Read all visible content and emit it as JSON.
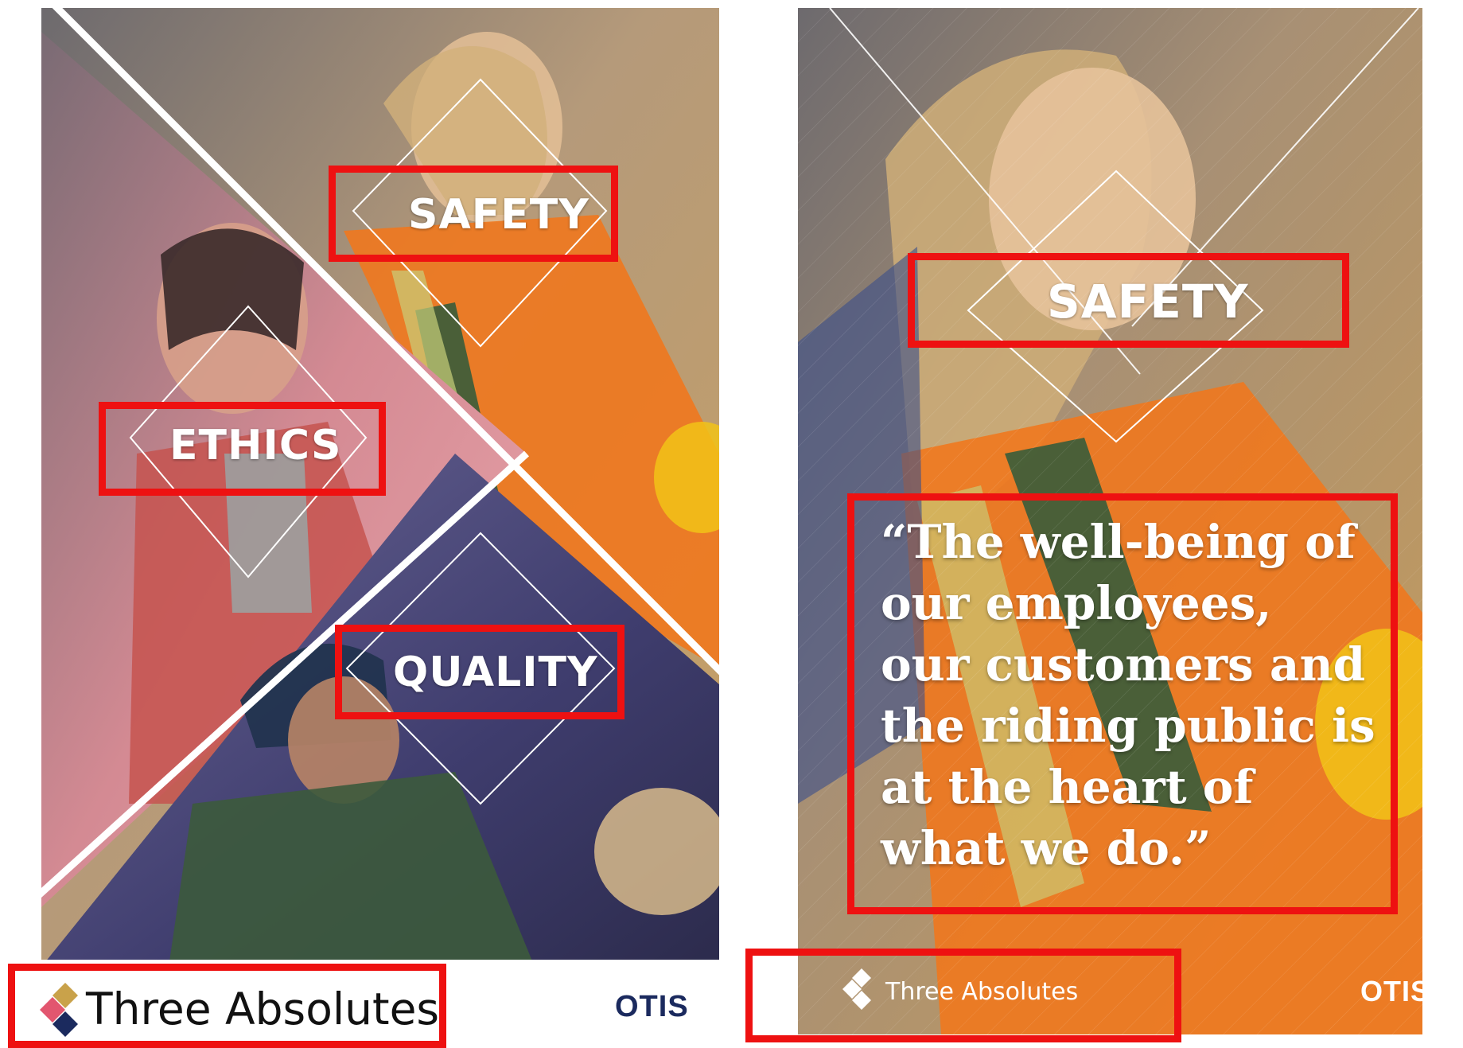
{
  "left_poster": {
    "values": [
      "SAFETY",
      "ETHICS",
      "QUALITY"
    ],
    "brand": "Three Absolutes",
    "logo": "OTIS"
  },
  "right_poster": {
    "value": "SAFETY",
    "quote_lines": [
      "“The well-being of",
      "our employees,",
      "our customers and",
      "the riding public is",
      "at the heart of",
      "what we do.”"
    ],
    "brand": "Three Absolutes",
    "logo": "OTIS"
  },
  "colors": {
    "highlight_red": "#ee1111",
    "otis_navy": "#1b2a5e",
    "safety_orange": "#f0781e",
    "ethics_pink": "#e8909a",
    "quality_blue": "#4a4a86",
    "logo_gold": "#c9a24a",
    "logo_pink": "#e2566f",
    "logo_navy": "#1b2a5e"
  },
  "icons": [
    "three-absolutes-diamond-logo-icon",
    "otis-wordmark"
  ]
}
